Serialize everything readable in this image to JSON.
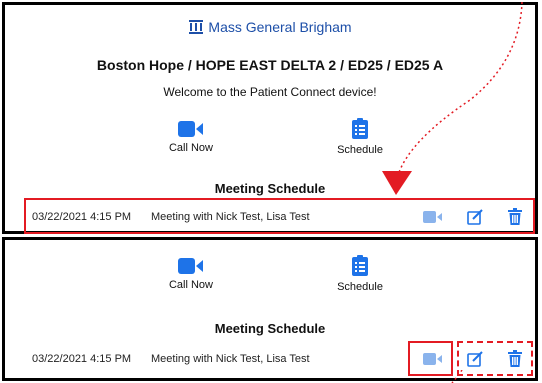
{
  "top_panel": {
    "brand": "Mass General Brigham",
    "location": "Boston Hope / HOPE EAST DELTA 2 / ED25 / ED25 A",
    "welcome": "Welcome to the Patient Connect device!",
    "call_now": "Call Now",
    "schedule": "Schedule",
    "meeting_schedule": "Meeting Schedule",
    "meeting": {
      "date": "03/22/2021 4:15 PM",
      "title": "Meeting with Nick Test, Lisa Test"
    }
  },
  "bottom_panel": {
    "call_now": "Call Now",
    "schedule": "Schedule",
    "meeting_schedule": "Meeting Schedule",
    "meeting": {
      "date": "03/22/2021 4:15 PM",
      "title": "Meeting with Nick Test, Lisa Test"
    }
  },
  "colors": {
    "accent_blue": "#1e73e8",
    "brand_blue": "#1d4fa8",
    "annotation_red": "#e31b23",
    "disabled_video": "#8ab3ec"
  },
  "icons": [
    "mgb-logo-icon",
    "video-camera-icon",
    "schedule-list-icon",
    "edit-icon",
    "trash-icon"
  ]
}
